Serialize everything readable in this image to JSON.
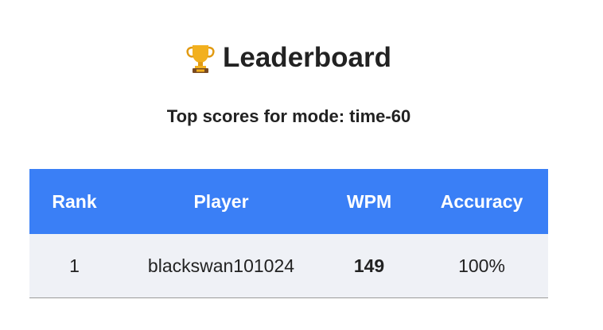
{
  "header": {
    "icon": "trophy-icon",
    "title": "Leaderboard",
    "subtitle": "Top scores for mode: time-60"
  },
  "table": {
    "columns": [
      "Rank",
      "Player",
      "WPM",
      "Accuracy"
    ],
    "rows": [
      {
        "rank": "1",
        "player": "blackswan101024",
        "wpm": "149",
        "accuracy": "100%"
      }
    ]
  },
  "colors": {
    "header_bg": "#3a7ff6",
    "row_bg": "#eff1f6",
    "trophy_gold": "#f2b01e"
  }
}
